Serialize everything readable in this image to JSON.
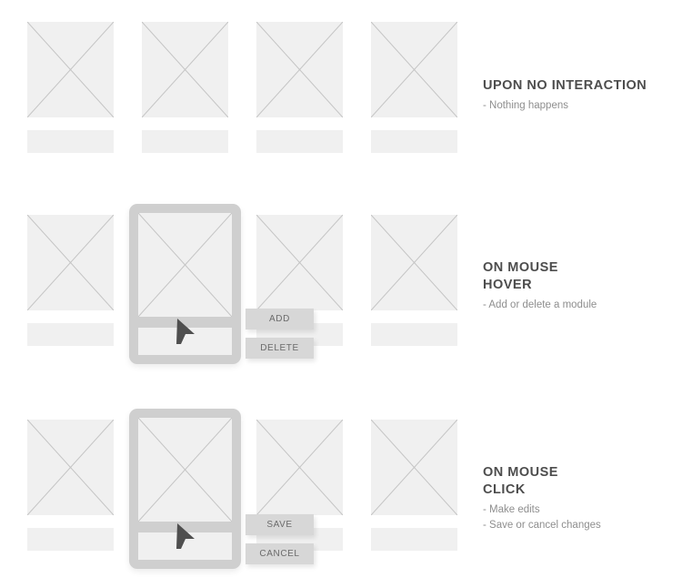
{
  "page": {
    "background_color": "#ffffff",
    "title": "Module interaction states wireframe"
  },
  "palette": {
    "placeholder_fill": "#f0f0f0",
    "placeholder_stroke": "#c4c4c4",
    "selected_frame": "#cfcfcf",
    "button_fill": "#d7d7d7",
    "button_text": "#6b6b6b",
    "heading_text": "#4d4d4d",
    "body_text": "#8e8e8e",
    "cursor_fill": "#4f4f4f"
  },
  "rows": [
    {
      "id": "row-1",
      "state": "no-interaction",
      "annotation": {
        "heading": "UPON NO INTERACTION",
        "bullets": [
          "- Nothing happens"
        ]
      },
      "modules": [
        {
          "index": 1,
          "selected": false
        },
        {
          "index": 2,
          "selected": false
        },
        {
          "index": 3,
          "selected": false
        },
        {
          "index": 4,
          "selected": false
        }
      ],
      "buttons": []
    },
    {
      "id": "row-2",
      "state": "mouse-hover",
      "annotation": {
        "heading": "ON MOUSE\nHOVER",
        "bullets": [
          "- Add or delete a module"
        ]
      },
      "modules": [
        {
          "index": 1,
          "selected": false
        },
        {
          "index": 2,
          "selected": true
        },
        {
          "index": 3,
          "selected": false
        },
        {
          "index": 4,
          "selected": false
        }
      ],
      "buttons": [
        {
          "id": "add",
          "label": "ADD"
        },
        {
          "id": "delete",
          "label": "DELETE"
        }
      ],
      "cursor_visible": true
    },
    {
      "id": "row-3",
      "state": "mouse-click",
      "annotation": {
        "heading": "ON MOUSE\nCLICK",
        "bullets": [
          "- Make edits",
          "- Save or cancel changes"
        ]
      },
      "modules": [
        {
          "index": 1,
          "selected": false
        },
        {
          "index": 2,
          "selected": true
        },
        {
          "index": 3,
          "selected": false
        },
        {
          "index": 4,
          "selected": false
        }
      ],
      "buttons": [
        {
          "id": "save",
          "label": "SAVE"
        },
        {
          "id": "cancel",
          "label": "CANCEL"
        }
      ],
      "cursor_visible": true
    }
  ],
  "icons": {
    "placeholder": "image-placeholder-x-icon",
    "cursor": "mouse-cursor-icon"
  }
}
